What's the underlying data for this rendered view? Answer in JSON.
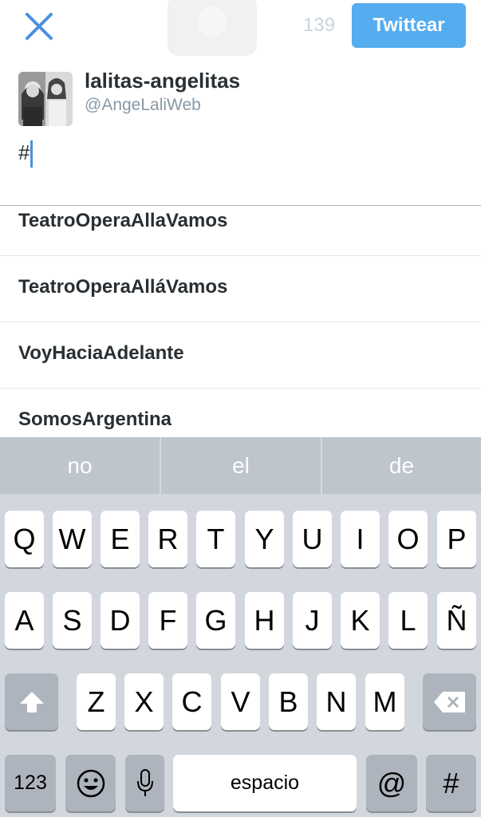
{
  "header": {
    "char_count": "139",
    "tweet_button_label": "Twittear"
  },
  "account": {
    "display_name": "lalitas-angelitas",
    "handle": "@AngeLaliWeb"
  },
  "compose": {
    "text": "#"
  },
  "suggestions": [
    "TeatroOperaAllaVamos",
    "TeatroOperaAlláVamos",
    "VoyHaciaAdelante",
    "SomosArgentina"
  ],
  "keyboard": {
    "predictions": [
      "no",
      "el",
      "de"
    ],
    "row1": [
      "Q",
      "W",
      "E",
      "R",
      "T",
      "Y",
      "U",
      "I",
      "O",
      "P"
    ],
    "row2": [
      "A",
      "S",
      "D",
      "F",
      "G",
      "H",
      "J",
      "K",
      "L",
      "Ñ"
    ],
    "row3": [
      "Z",
      "X",
      "C",
      "V",
      "B",
      "N",
      "M"
    ],
    "numbers_label": "123",
    "space_label": "espacio",
    "at_label": "@",
    "hash_label": "#"
  }
}
